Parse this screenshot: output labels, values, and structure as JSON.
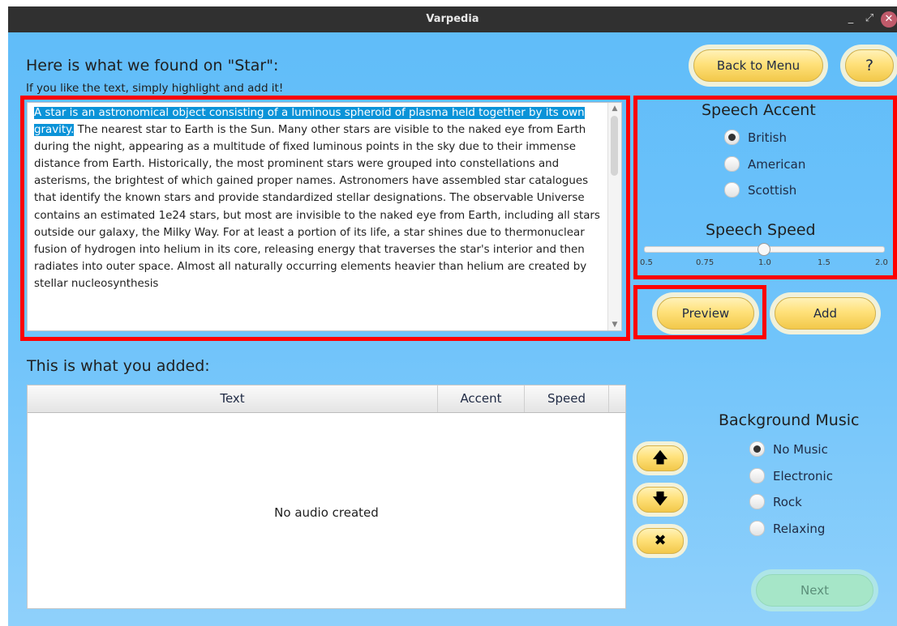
{
  "window": {
    "title": "Varpedia"
  },
  "titlebar": {
    "minimize": "_",
    "maximize": "⤢",
    "close": "✕"
  },
  "header": {
    "title": "Here is what we found on \"Star\":",
    "subtitle": "If you like the text, simply highlight and add it!"
  },
  "buttons": {
    "back_to_menu": "Back to Menu",
    "help": "?",
    "preview": "Preview",
    "add": "Add",
    "next": "Next"
  },
  "article": {
    "selected_text": "A star is an astronomical object consisting of a luminous spheroid of plasma held together by its own gravity.",
    "rest_text": " The nearest star to Earth is the Sun. Many other stars are visible to the naked eye from Earth during the night, appearing as a multitude of fixed luminous points in the sky due to their immense distance from Earth. Historically, the most prominent stars were grouped into constellations and asterisms, the brightest of which gained proper names. Astronomers have assembled star catalogues that identify the known stars and provide standardized stellar designations. The observable Universe contains an estimated 1e24 stars, but most are invisible to the naked eye from Earth, including all stars outside our galaxy, the Milky Way. For at least a portion of its life, a star shines due to thermonuclear fusion of hydrogen into helium in its core, releasing energy that traverses the star's interior and then radiates into outer space. Almost all naturally occurring elements heavier than helium are created by stellar nucleosynthesis"
  },
  "speech_accent": {
    "title": "Speech Accent",
    "options": [
      "British",
      "American",
      "Scottish"
    ],
    "selected": "British"
  },
  "speech_speed": {
    "title": "Speech Speed",
    "ticks": [
      "0.5",
      "0.75",
      "1.0",
      "1.5",
      "2.0"
    ],
    "value": 1.0
  },
  "added": {
    "title": "This is what you added:",
    "columns": [
      "Text",
      "Accent",
      "Speed"
    ],
    "empty_message": "No audio created"
  },
  "reorder": {
    "up_icon": "arrow-up-icon",
    "down_icon": "arrow-down-icon",
    "delete_icon": "close-icon",
    "up": "🡅",
    "down": "🡇",
    "delete": "✖"
  },
  "background_music": {
    "title": "Background Music",
    "options": [
      "No Music",
      "Electronic",
      "Rock",
      "Relaxing"
    ],
    "selected": "No Music"
  },
  "colors": {
    "highlight": "#0b93d8",
    "annotation": "#ff0000",
    "button": "#ffe17a",
    "background": "#6ec3fa"
  }
}
